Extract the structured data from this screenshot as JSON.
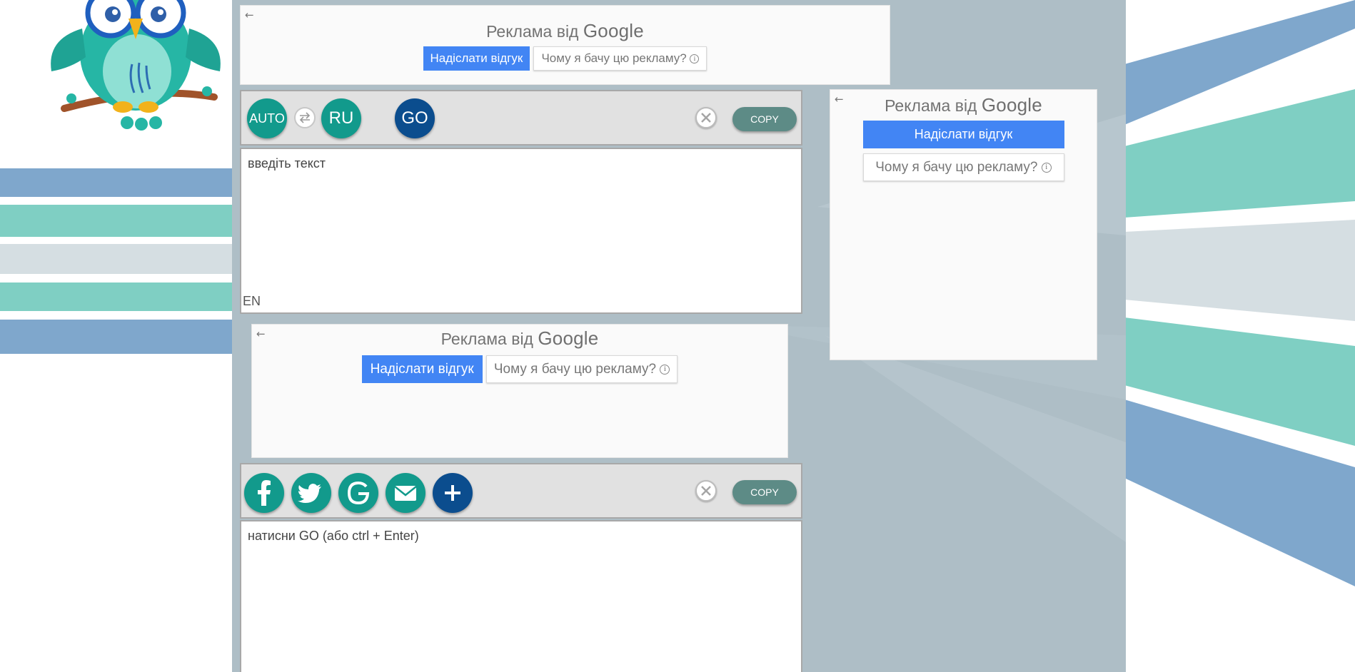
{
  "ads": {
    "brand_prefix": "Реклама від",
    "brand_name": "Google",
    "feedback_label": "Надіслати відгук",
    "why_label": "Чому я бачу цю рекламу?",
    "back_glyph": "←",
    "info_glyph": "i"
  },
  "translator": {
    "source_lang_button": "AUTO",
    "target_lang_button": "RU",
    "go_button": "GO",
    "copy_label": "COPY",
    "input_placeholder": "введіть текст",
    "input_lang_indicator": "EN",
    "output_placeholder": "натисни GO (або ctrl + Enter)"
  },
  "share": {
    "facebook": "facebook-icon",
    "twitter": "twitter-icon",
    "google": "google-icon",
    "email": "mail-icon",
    "more": "plus-icon"
  },
  "colors": {
    "teal": "#129a8c",
    "navy": "#0b4d8e",
    "copy": "#5d8b86",
    "google_blue": "#4285f4",
    "column": "#aebec6",
    "stripe_blue": "#7fa7cc",
    "stripe_teal": "#7fcfc3",
    "stripe_grey": "#d5dee2"
  }
}
